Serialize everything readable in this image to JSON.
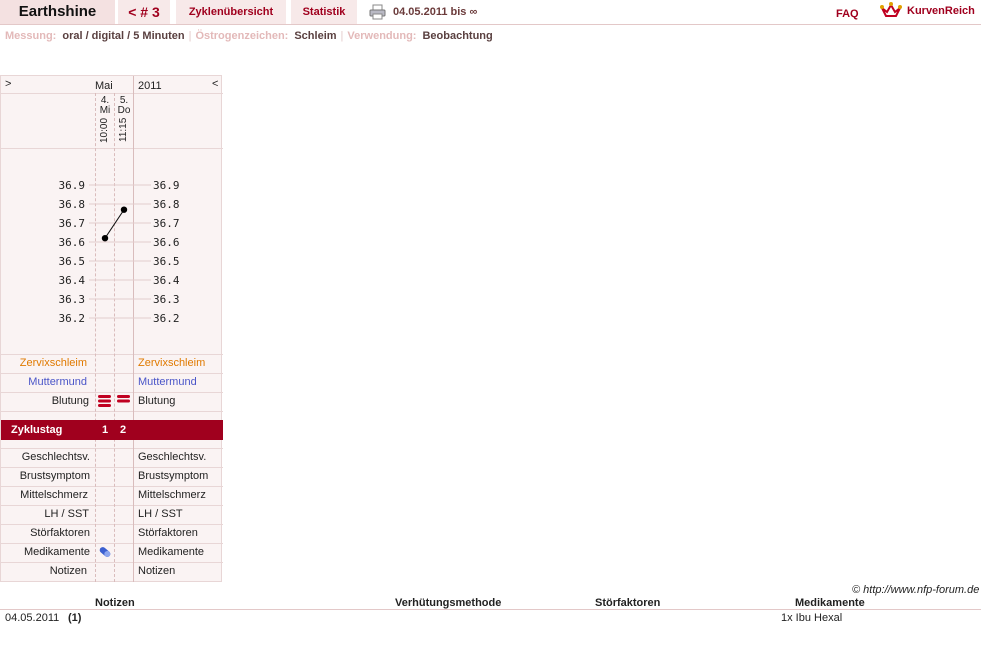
{
  "header": {
    "brand": "Earthshine",
    "cycle": "< # 3",
    "tab_zyklen": "Zyklenübersicht",
    "tab_statistik": "Statistik",
    "date_range": "04.05.2011 bis ∞",
    "faq": "FAQ",
    "logo_text": "KurvenReich"
  },
  "info": {
    "messung_label": "Messung:",
    "messung_value": "oral / digital / 5 Minuten",
    "oestrogen_label": "Östrogenzeichen:",
    "oestrogen_value": "Schleim",
    "verwendung_label": "Verwendung:",
    "verwendung_value": "Beobachtung"
  },
  "chart": {
    "nav_prev": ">",
    "nav_next": "<",
    "month": "Mai",
    "year": "2011",
    "days": [
      {
        "num": "4.",
        "weekday": "Mi",
        "time": "10:00",
        "temp": 36.62,
        "zyklustag": "1"
      },
      {
        "num": "5.",
        "weekday": "Do",
        "time": "11:15",
        "temp": 36.77,
        "zyklustag": "2"
      }
    ],
    "temp_ticks": [
      "36.9",
      "36.8",
      "36.7",
      "36.6",
      "36.5",
      "36.4",
      "36.3",
      "36.2"
    ],
    "rows": {
      "zervix": "Zervixschleim",
      "muttermund": "Muttermund",
      "blutung": "Blutung",
      "zyklustag": "Zyklustag",
      "geschlechtsv": "Geschlechtsv.",
      "brustsymptom": "Brustsymptom",
      "mittelschmerz": "Mittelschmerz",
      "lh": "LH / SST",
      "stoerfaktoren": "Störfaktoren",
      "medikamente": "Medikamente",
      "notizen": "Notizen"
    },
    "colors": {
      "zervix": "#e07a00",
      "muttermund": "#4a55c8",
      "accent": "#a0001e"
    }
  },
  "footer": {
    "copyright": "© http://www.nfp-forum.de",
    "headers": {
      "notizen": "Notizen",
      "verhuetung": "Verhütungsmethode",
      "stoerfaktoren": "Störfaktoren",
      "medikamente": "Medikamente"
    },
    "rows": [
      {
        "date": "04.05.2011",
        "day": "(1)",
        "medikamente": "1x Ibu Hexal"
      }
    ]
  }
}
